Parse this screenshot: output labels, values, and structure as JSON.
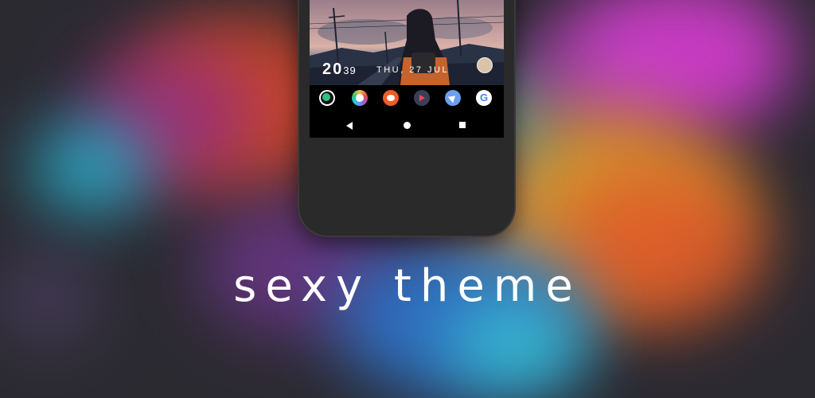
{
  "banner": {
    "headline": "sexy theme"
  },
  "lockscreen": {
    "clock_hours": "20",
    "clock_minutes": "39",
    "date": "THU, 27 JUL"
  },
  "dock": {
    "apps": [
      {
        "icon": "clock-app-icon"
      },
      {
        "icon": "photos-app-icon"
      },
      {
        "icon": "reddit-app-icon"
      },
      {
        "icon": "video-player-app-icon"
      },
      {
        "icon": "navigation-app-icon"
      },
      {
        "icon": "google-app-icon",
        "glyph": "G"
      }
    ]
  },
  "navbar": {
    "icons": [
      "back-icon",
      "home-icon",
      "recents-icon"
    ]
  },
  "colors": {
    "background": "#2b2a31",
    "phone_body": "#2a2a2a",
    "text": "#ffffff",
    "accent_green": "#2ec27e",
    "accent_orange": "#f25a27",
    "accent_blue": "#6aa0ee"
  }
}
